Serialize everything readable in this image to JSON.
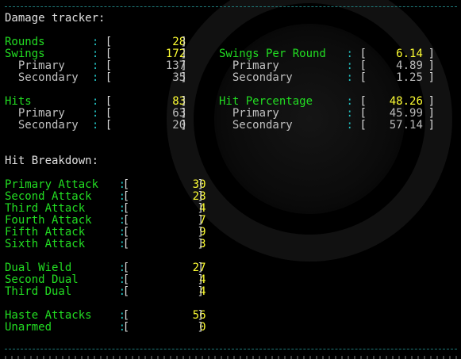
{
  "colors": {
    "background": "#000000",
    "heading": "#e0e0e0",
    "label_green": "#22dd22",
    "label_gray": "#c0c0c0",
    "value_yellow": "#ffff33",
    "value_gray": "#bbbbbb",
    "bracket": "#d8d8d8",
    "colon": "#22c0c0",
    "dash_line": "#1f7a7a"
  },
  "header": {
    "title": "Damage tracker:"
  },
  "stats_left": [
    {
      "label": "Rounds",
      "value": "28",
      "is_main": true
    },
    {
      "label": "Swings",
      "value": "172",
      "is_main": true
    },
    {
      "label": "  Primary",
      "value": "137",
      "is_main": false
    },
    {
      "label": "  Secondary",
      "value": "35",
      "is_main": false
    },
    {
      "label": "Hits",
      "value": "83",
      "is_main": true
    },
    {
      "label": "  Primary",
      "value": "63",
      "is_main": false
    },
    {
      "label": "  Secondary",
      "value": "20",
      "is_main": false
    }
  ],
  "stats_right": [
    {
      "label": "Swings Per Round",
      "value": "6.14",
      "is_main": true
    },
    {
      "label": "  Primary",
      "value": "4.89",
      "is_main": false
    },
    {
      "label": "  Secondary",
      "value": "1.25",
      "is_main": false
    },
    {
      "label": "Hit Percentage",
      "value": "48.26",
      "is_main": true
    },
    {
      "label": "  Primary",
      "value": "45.99",
      "is_main": false
    },
    {
      "label": "  Secondary",
      "value": "57.14",
      "is_main": false
    }
  ],
  "breakdown": {
    "title": "Hit Breakdown:",
    "groups": [
      [
        {
          "label": "Primary Attack",
          "value": "30"
        },
        {
          "label": "Second Attack",
          "value": "28"
        },
        {
          "label": "Third Attack",
          "value": "4"
        },
        {
          "label": "Fourth Attack",
          "value": "7"
        },
        {
          "label": "Fifth Attack",
          "value": "9"
        },
        {
          "label": "Sixth Attack",
          "value": "3"
        }
      ],
      [
        {
          "label": "Dual Wield",
          "value": "27"
        },
        {
          "label": "Second Dual",
          "value": "4"
        },
        {
          "label": "Third Dual",
          "value": "4"
        }
      ],
      [
        {
          "label": "Haste Attacks",
          "value": "56"
        },
        {
          "label": "Unarmed",
          "value": "0"
        }
      ]
    ]
  }
}
